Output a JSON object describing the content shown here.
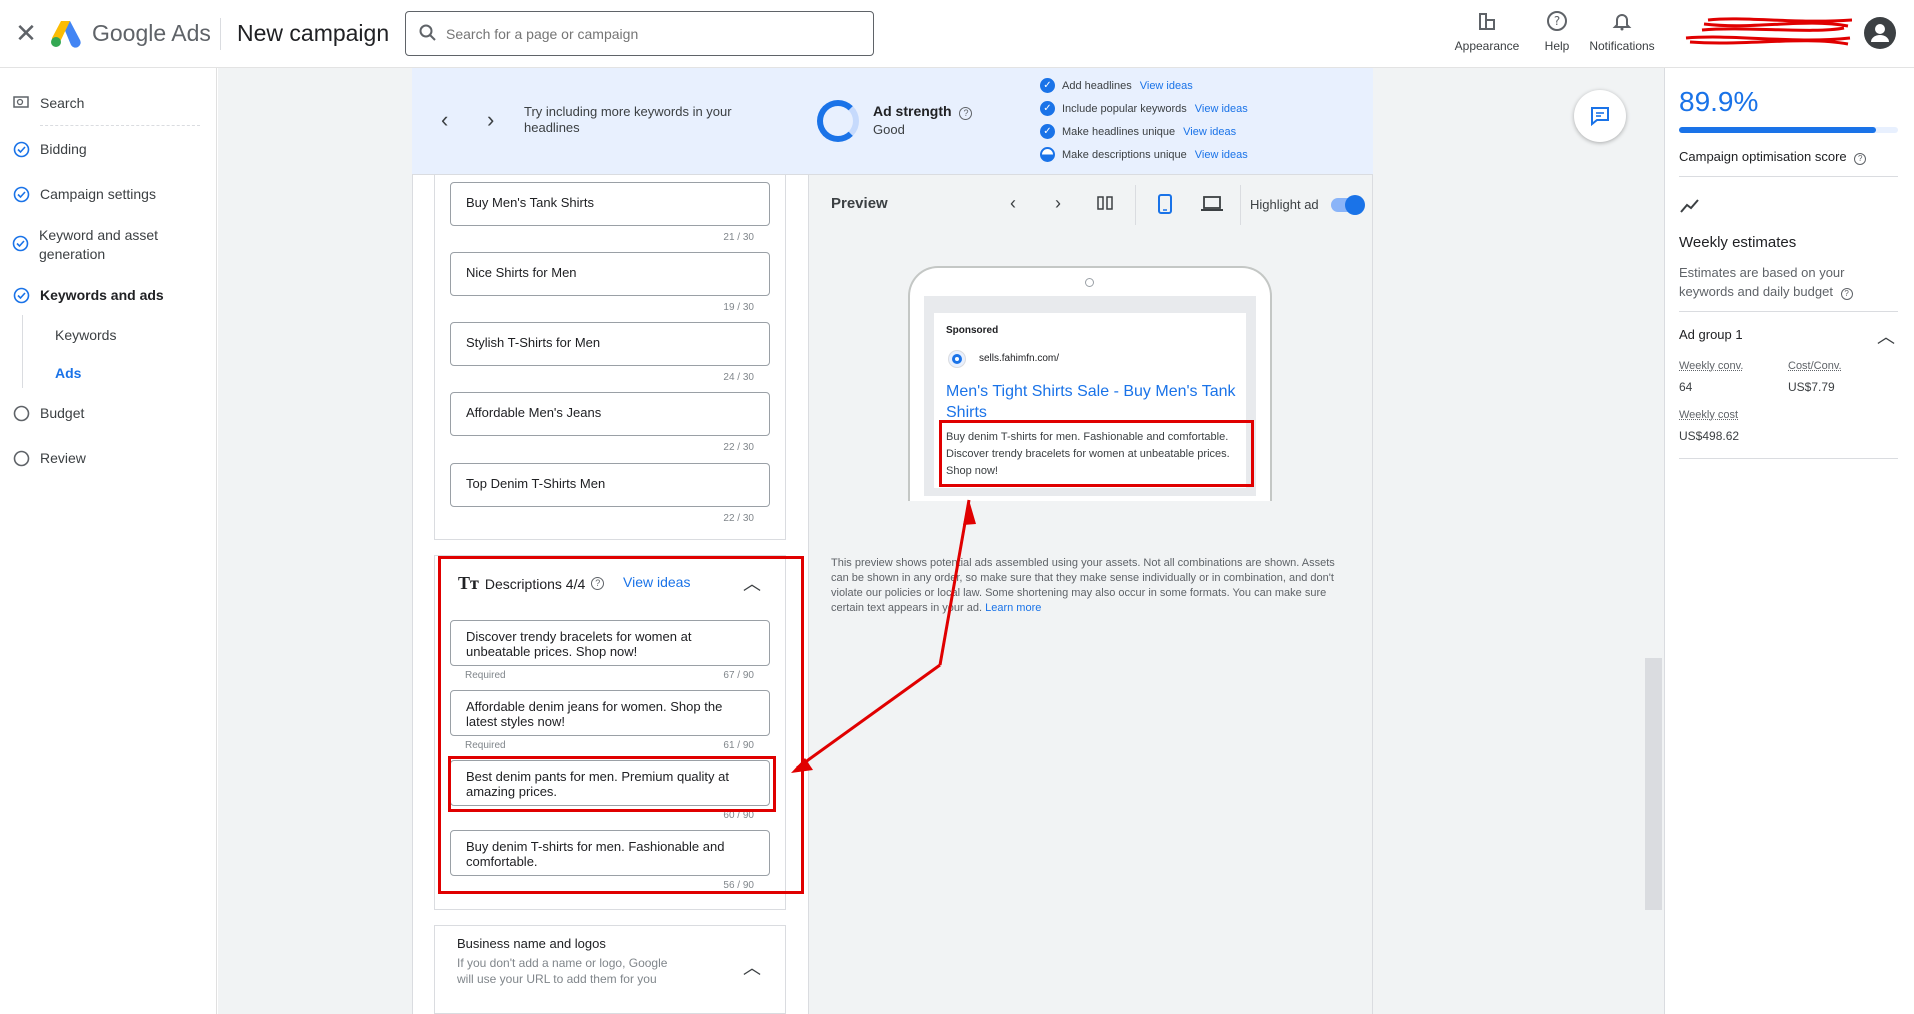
{
  "header": {
    "brand": "Google Ads",
    "page_title": "New campaign",
    "search_placeholder": "Search for a page or campaign",
    "tools": [
      {
        "label": "Appearance",
        "icon": "appearance-icon"
      },
      {
        "label": "Help",
        "icon": "help-icon"
      },
      {
        "label": "Notifications",
        "icon": "bell-icon"
      }
    ]
  },
  "nav": {
    "items": [
      {
        "label": "Search",
        "icon": "campaign-icon"
      },
      {
        "label": "Bidding",
        "icon": "check-circle-icon"
      },
      {
        "label": "Campaign settings",
        "icon": "check-circle-icon"
      },
      {
        "label": "Keyword and asset generation",
        "icon": "check-circle-icon"
      },
      {
        "label": "Keywords and ads",
        "icon": "check-circle-icon"
      },
      {
        "label": "Budget",
        "icon": "empty-circle-icon"
      },
      {
        "label": "Review",
        "icon": "empty-circle-icon"
      }
    ],
    "sub_items": [
      "Keywords",
      "Ads"
    ]
  },
  "banner": {
    "tip_text": "Try including more keywords in your headlines",
    "strength_title": "Ad strength",
    "strength_value": "Good",
    "checks": [
      {
        "label": "Add headlines",
        "link": "View ideas"
      },
      {
        "label": "Include popular keywords",
        "link": "View ideas"
      },
      {
        "label": "Make headlines unique",
        "link": "View ideas"
      },
      {
        "label": "Make descriptions unique",
        "link": "View ideas"
      }
    ]
  },
  "headlines": [
    {
      "text": "Buy Men's Tank Shirts",
      "count": "21 / 30"
    },
    {
      "text": "Nice Shirts for Men",
      "count": "19 / 30"
    },
    {
      "text": "Stylish T-Shirts for Men",
      "count": "24 / 30"
    },
    {
      "text": "Affordable Men's Jeans",
      "count": "22 / 30"
    },
    {
      "text": "Top Denim T-Shirts Men",
      "count": "22 / 30"
    }
  ],
  "descriptions": {
    "title": "Descriptions 4/4",
    "view_ideas": "View ideas",
    "required_label": "Required",
    "items": [
      {
        "text": "Discover trendy bracelets for women at unbeatable prices. Shop now!",
        "count": "67 / 90"
      },
      {
        "text": "Affordable denim jeans for women. Shop the latest styles now!",
        "count": "61 / 90"
      },
      {
        "text": "Best denim pants for men. Premium quality at amazing prices.",
        "count": "60 / 90"
      },
      {
        "text": "Buy denim T-shirts for men. Fashionable and comfortable.",
        "count": "56 / 90"
      }
    ]
  },
  "business": {
    "title": "Business name and logos",
    "subtitle": "If you don't add a name or logo, Google will use your URL to add them for you"
  },
  "preview": {
    "title": "Preview",
    "highlight_label": "Highlight ad",
    "highlight_on": true,
    "ad": {
      "sponsored": "Sponsored",
      "url": "sells.fahimfn.com/",
      "headline": "Men's Tight Shirts Sale - Buy Men's Tank Shirts",
      "description": "Buy denim T-shirts for men. Fashionable and comfortable. Discover trendy bracelets for women at unbeatable prices. Shop now!"
    },
    "note": "This preview shows potential ads assembled using your assets. Not all combinations are shown. Assets can be shown in any order, so make sure that they make sense individually or in combination, and don't violate our policies or local law. Some shortening may also occur in some formats. You can make sure certain text appears in your ad.",
    "learn_more": "Learn more"
  },
  "right": {
    "score": "89.9%",
    "score_fraction": 0.899,
    "score_label": "Campaign optimisation score",
    "weekly_title": "Weekly estimates",
    "weekly_sub": "Estimates are based on your keywords and daily budget",
    "ad_group": "Ad group 1",
    "metrics": [
      {
        "label": "Weekly conv.",
        "value": "64"
      },
      {
        "label": "Cost/Conv.",
        "value": "US$7.79"
      },
      {
        "label": "Weekly cost",
        "value": "US$498.62"
      }
    ]
  },
  "colors": {
    "accent": "#1a73e8",
    "annotation": "#e00000"
  }
}
